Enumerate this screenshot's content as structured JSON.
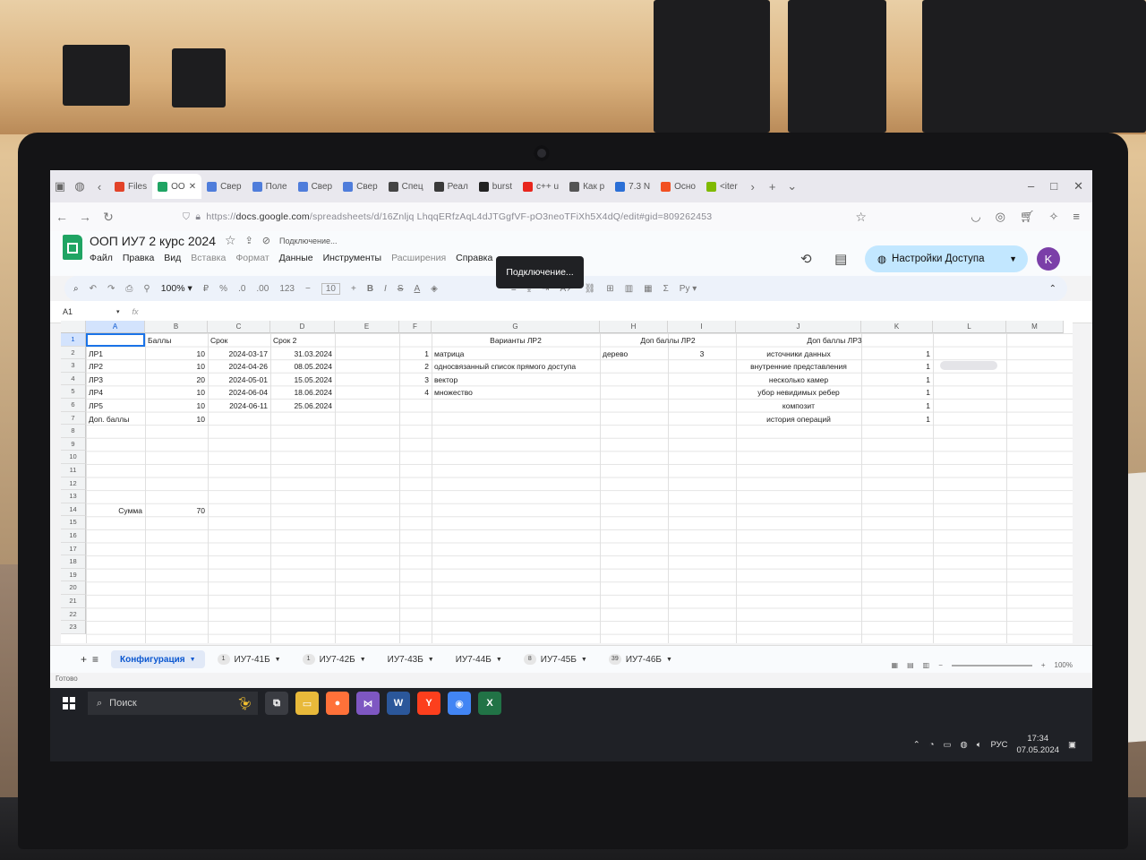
{
  "browser": {
    "tabs": [
      {
        "label": "Files",
        "color": "#e24329"
      },
      {
        "label": "OO",
        "color": "#1fa463",
        "active": true
      },
      {
        "label": "Свер",
        "color": "#4f7ddb"
      },
      {
        "label": "Поле",
        "color": "#4f7ddb"
      },
      {
        "label": "Свер",
        "color": "#4f7ddb"
      },
      {
        "label": "Свер",
        "color": "#4f7ddb"
      },
      {
        "label": "Спец",
        "color": "#444444"
      },
      {
        "label": "Реал",
        "color": "#3a3a3a"
      },
      {
        "label": "burst",
        "color": "#222222"
      },
      {
        "label": "c++ u",
        "color": "#e8261d"
      },
      {
        "label": "Как р",
        "color": "#555555"
      },
      {
        "label": "7.3 N",
        "color": "#2b6fd6"
      },
      {
        "label": "Осно",
        "color": "#f25022"
      },
      {
        "label": "<iter",
        "color": "#7fba00"
      }
    ],
    "url_prefix": "https://",
    "url_host": "docs.google.com",
    "url_path": "/spreadsheets/d/16Znljq LhqqERfzAqL4dJTGgfVF-pO3neoTFiXh5X4dQ/edit#gid=809262453"
  },
  "sheets": {
    "title": "ООП ИУ7 2 курс 2024",
    "status_text": "Подключение...",
    "menus": [
      {
        "label": "Файл",
        "dim": false
      },
      {
        "label": "Правка",
        "dim": false
      },
      {
        "label": "Вид",
        "dim": false
      },
      {
        "label": "Вставка",
        "dim": true
      },
      {
        "label": "Формат",
        "dim": true
      },
      {
        "label": "Данные",
        "dim": false
      },
      {
        "label": "Инструменты",
        "dim": false
      },
      {
        "label": "Расширения",
        "dim": true
      },
      {
        "label": "Справка",
        "dim": false
      }
    ],
    "tooltip": "Подключение...",
    "share_label": "Настройки Доступа",
    "avatar_letter": "K",
    "zoom": "100%",
    "font_size": "10",
    "cell_ref": "A1",
    "formula_fx": "fx",
    "toolbar_lang": "Ру",
    "columns": [
      "A",
      "B",
      "C",
      "D",
      "E",
      "F",
      "G",
      "H",
      "I",
      "J",
      "K",
      "L",
      "M"
    ],
    "rows": [
      "1",
      "2",
      "3",
      "4",
      "5",
      "6",
      "7",
      "8",
      "9",
      "10",
      "11",
      "12",
      "13",
      "14",
      "15",
      "16",
      "17",
      "18",
      "19",
      "20",
      "21",
      "22",
      "23"
    ],
    "cells": {
      "B1": "Баллы",
      "C1": "Срок",
      "D1": "Срок 2",
      "A2": "ЛР1",
      "B2": "10",
      "C2": "2024-03-17",
      "D2": "31.03.2024",
      "A3": "ЛР2",
      "B3": "10",
      "C3": "2024-04-26",
      "D3": "08.05.2024",
      "A4": "ЛР3",
      "B4": "20",
      "C4": "2024-05-01",
      "D4": "15.05.2024",
      "A5": "ЛР4",
      "B5": "10",
      "C5": "2024-06-04",
      "D5": "18.06.2024",
      "A6": "ЛР5",
      "B6": "10",
      "C6": "2024-06-11",
      "D6": "25.06.2024",
      "A7": "Доп. баллы",
      "B7": "10",
      "A14": "Сумма",
      "B14": "70",
      "G1": "Варианты ЛР2",
      "F2": "1",
      "G2": "матрица",
      "F3": "2",
      "G3": "односвязанный список прямого доступа",
      "F4": "3",
      "G4": "вектор",
      "F5": "4",
      "G5": "множество",
      "HI1": "Доп баллы ЛР2",
      "H2": "дерево",
      "I2": "3",
      "JK1": "Доп баллы ЛР3",
      "J2": "источники данных",
      "K2": "1",
      "J3": "внутренние представления",
      "K3": "1",
      "J4": "несколько камер",
      "K4": "1",
      "J5": "убор невидимых ребер",
      "K5": "1",
      "J6": "композит",
      "K6": "1",
      "J7": "история операций",
      "K7": "1"
    },
    "sheet_tabs": [
      {
        "label": "Конфигурация",
        "badge": "",
        "active": true
      },
      {
        "label": "ИУ7-41Б",
        "badge": "1",
        "active": false
      },
      {
        "label": "ИУ7-42Б",
        "badge": "1",
        "active": false
      },
      {
        "label": "ИУ7-43Б",
        "badge": "",
        "active": false
      },
      {
        "label": "ИУ7-44Б",
        "badge": "",
        "active": false
      },
      {
        "label": "ИУ7-45Б",
        "badge": "8",
        "active": false
      },
      {
        "label": "ИУ7-46Б",
        "badge": "39",
        "active": false
      }
    ],
    "statusbar": "Готово",
    "bottom_zoom": "100%"
  },
  "taskbar": {
    "search_label": "Поиск",
    "apps": [
      {
        "name": "task-view",
        "label": "⧉",
        "color": "#3a3c42"
      },
      {
        "name": "file-explorer",
        "label": "▭",
        "color": "#e8b93a"
      },
      {
        "name": "firefox",
        "label": "●",
        "color": "#ff7139"
      },
      {
        "name": "visual-studio",
        "label": "⋈",
        "color": "#7e57c2"
      },
      {
        "name": "word",
        "label": "W",
        "color": "#2b579a"
      },
      {
        "name": "yandex",
        "label": "Y",
        "color": "#fc3f1d"
      },
      {
        "name": "chrome",
        "label": "◉",
        "color": "#4285f4"
      },
      {
        "name": "excel",
        "label": "X",
        "color": "#217346"
      }
    ],
    "lang": "РУС",
    "time": "17:34",
    "date": "07.05.2024"
  }
}
